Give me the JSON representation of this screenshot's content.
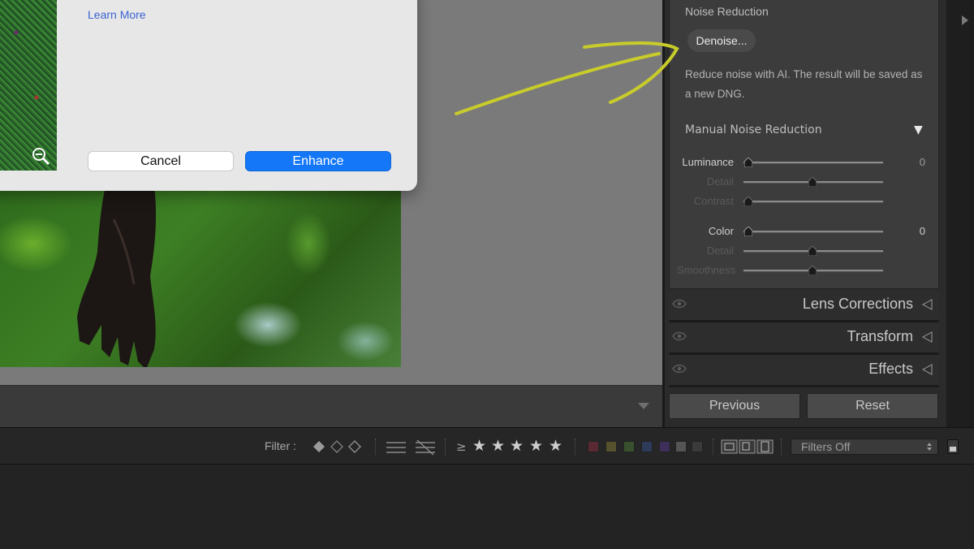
{
  "dialog": {
    "learn_more": "Learn More",
    "cancel": "Cancel",
    "enhance": "Enhance"
  },
  "detail_panel": {
    "noise_reduction_title": "Noise Reduction",
    "denoise_button": "Denoise...",
    "description": "Reduce noise with AI. The result will be saved as a new DNG.",
    "manual_title": "Manual Noise Reduction",
    "manual_toggle": "▼",
    "sliders": [
      {
        "label": "Luminance",
        "value": "0",
        "position": 0.0
      },
      {
        "label": "Detail",
        "value": "",
        "position": 0.5
      },
      {
        "label": "Contrast",
        "value": "",
        "position": 0.0
      },
      {
        "label": "Color",
        "value": "0",
        "position": 0.0
      },
      {
        "label": "Detail",
        "value": "",
        "position": 0.5
      },
      {
        "label": "Smoothness",
        "value": "",
        "position": 0.5
      }
    ]
  },
  "sections": [
    {
      "title": "Lens Corrections"
    },
    {
      "title": "Transform"
    },
    {
      "title": "Effects"
    }
  ],
  "panel_buttons": {
    "previous": "Previous",
    "reset": "Reset"
  },
  "filter_bar": {
    "label": "Filter :",
    "rating_operator": "≥",
    "stars": 5,
    "dropdown_value": "Filters Off",
    "color_labels": [
      "#8a3a45",
      "#6e6a3a",
      "#4d6e3d",
      "#3d4d7e",
      "#5a3d7e",
      "#5a5a5a",
      "#404040"
    ]
  },
  "colors": {
    "accent_blue": "#1477f8",
    "arrow_annotation": "#c8cc2a"
  }
}
